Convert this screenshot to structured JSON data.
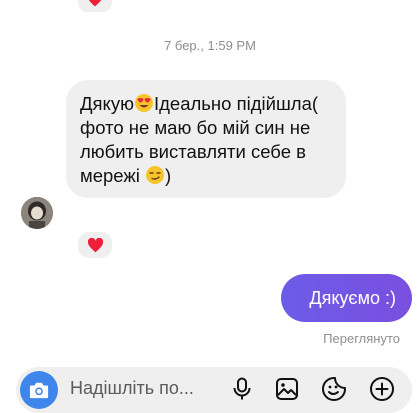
{
  "timestamp": "7 бер., 1:59 PM",
  "messages": {
    "incoming": {
      "text_before_emoji": "Дякую",
      "text_after_emoji": "Ідеально підійшла( фото не маю бо мій син не любить виставляти себе в мережі ",
      "text_end": ")",
      "reaction": "heart-red"
    },
    "outgoing": {
      "text": "Дякуємо :)",
      "status": "Переглянуто"
    }
  },
  "composer": {
    "placeholder": "Надішліть по..."
  },
  "colors": {
    "accent": "#6c5ce7",
    "camera": "#3e86ec",
    "heart": "#ed1f3a",
    "bubble_in": "#efefef"
  },
  "icons": {
    "camera": "camera-icon",
    "mic": "microphone-icon",
    "gallery": "image-icon",
    "sticker": "sticker-icon",
    "add": "plus-icon"
  }
}
